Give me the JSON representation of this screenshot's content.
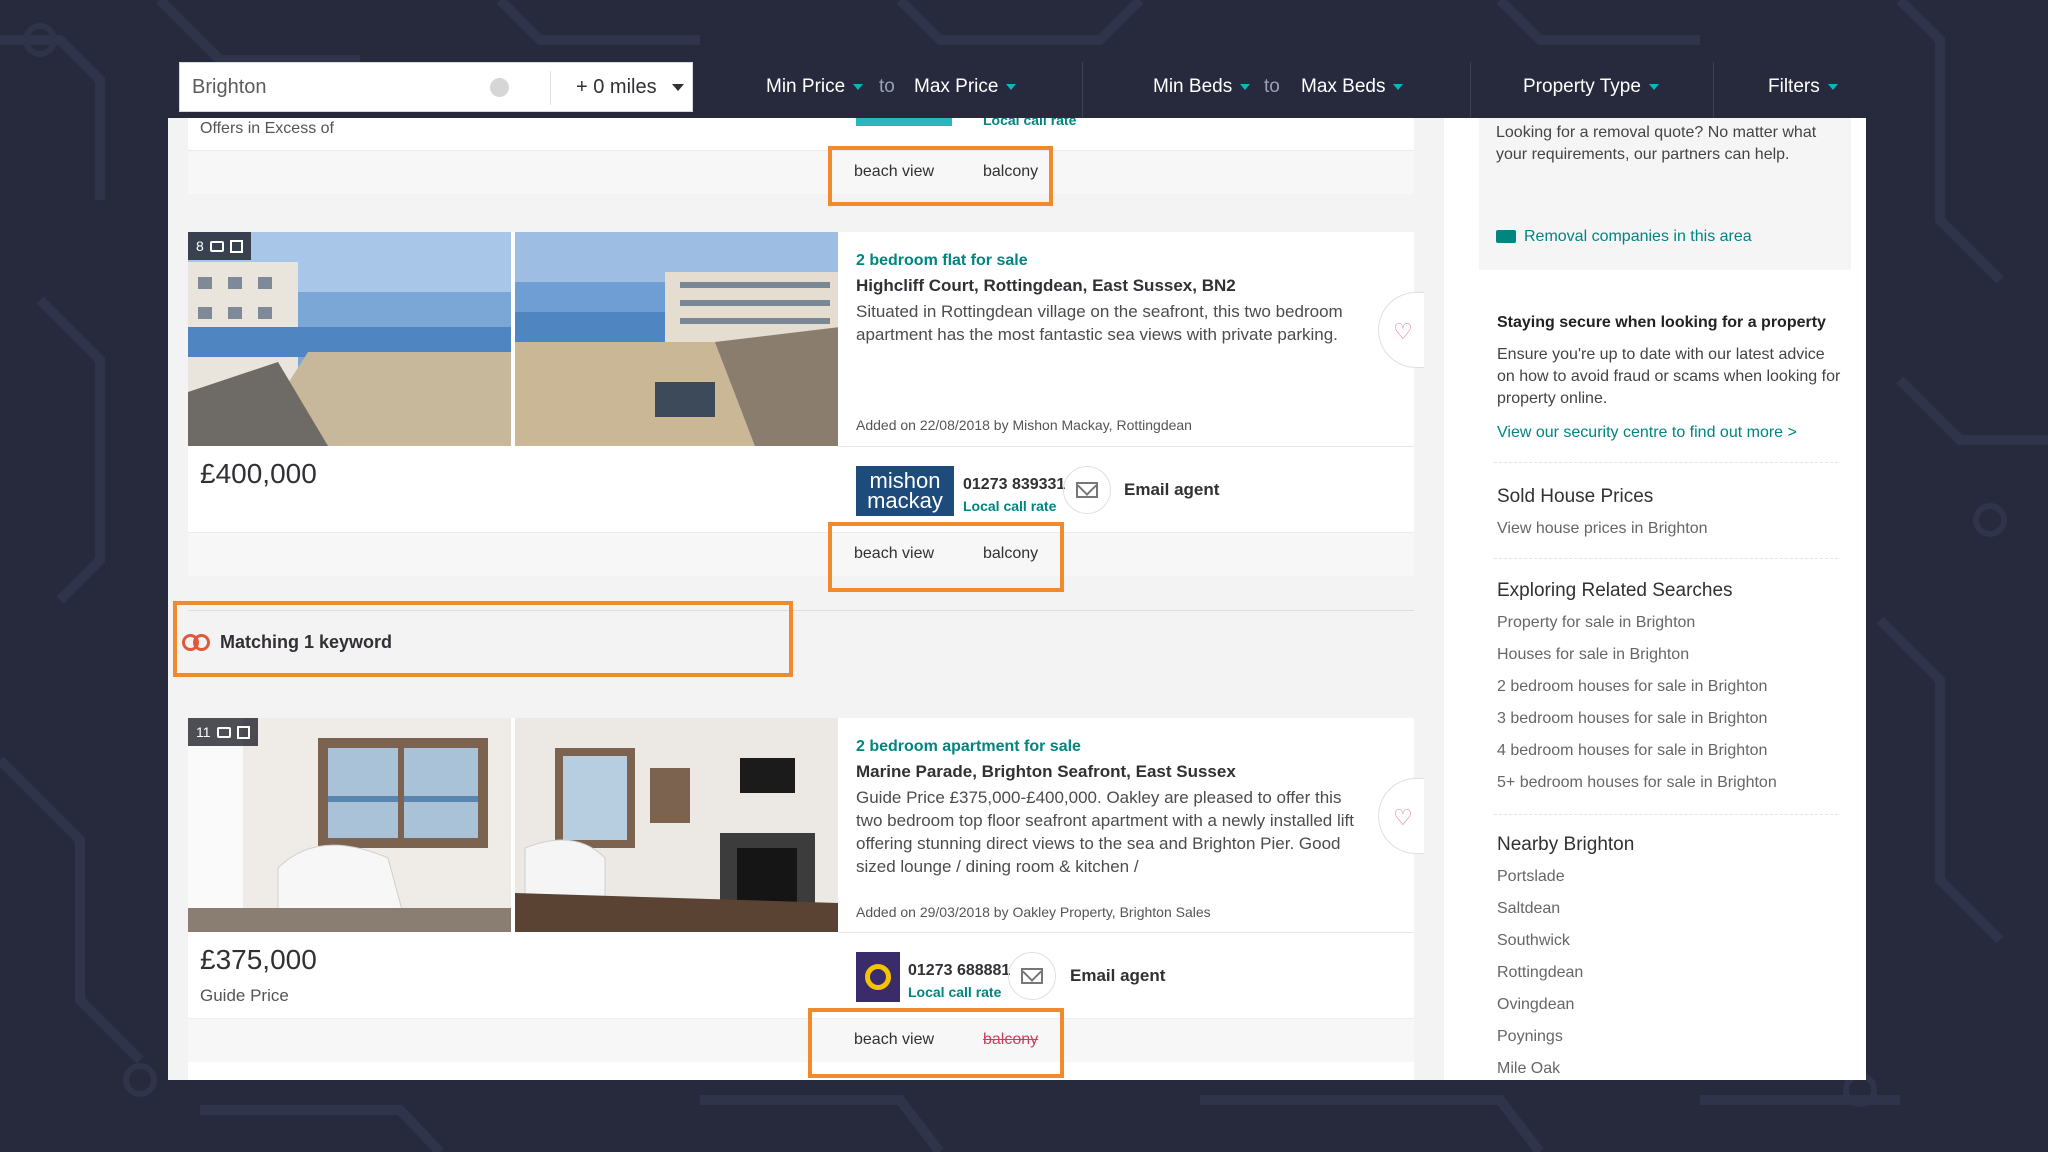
{
  "colors": {
    "bg": "#262a3c",
    "accent": "#11b4b7",
    "teal": "#00857f",
    "highlight": "#f1892d",
    "strike": "#d23b5e"
  },
  "search": {
    "location": "Brighton",
    "radius": "+ 0 miles"
  },
  "filters": {
    "min_price": "Min Price",
    "max_price": "Max Price",
    "to": "to",
    "min_beds": "Min Beds",
    "max_beds": "Max Beds",
    "property_type": "Property Type",
    "filters": "Filters"
  },
  "listing0": {
    "price_qualifier": "Offers in Excess of",
    "local_call": "Local call rate",
    "tags": [
      "beach view",
      "balcony"
    ]
  },
  "listing1": {
    "photo_count": "8",
    "type": "2 bedroom flat for sale",
    "address": "Highcliff Court, Rottingdean, East Sussex, BN2",
    "description": "Situated in Rottingdean village on the seafront, this two bedroom apartment has the most fantastic sea views with private parking.",
    "added": "Added on 22/08/2018 by Mishon Mackay, Rottingdean",
    "price": "£400,000",
    "agent_logo_top": "mishon",
    "agent_logo_bottom": "mackay",
    "phone": "01273 839331",
    "local_call": "Local call rate",
    "email": "Email agent",
    "tags": [
      "beach view",
      "balcony"
    ]
  },
  "matching": {
    "label": "Matching 1 keyword"
  },
  "listing2": {
    "photo_count": "11",
    "type": "2 bedroom apartment for sale",
    "address": "Marine Parade, Brighton Seafront, East Sussex",
    "description": "Guide Price £375,000-£400,000. Oakley are pleased to offer this two bedroom top floor seafront apartment with a newly installed lift offering stunning direct views to the sea and Brighton Pier. Good sized lounge / dining room & kitchen /",
    "added": "Added on 29/03/2018 by Oakley Property, Brighton Sales",
    "price": "£375,000",
    "price_qualifier": "Guide Price",
    "phone": "01273 688881",
    "local_call": "Local call rate",
    "email": "Email agent",
    "tags": [
      "beach view",
      "balcony"
    ]
  },
  "sidebar": {
    "removal_text": "Looking for a removal quote? No matter what your requirements, our partners can help.",
    "removal_link": "Removal companies in this area",
    "secure_title": "Staying secure when looking for a property",
    "secure_text": "Ensure you're up to date with our latest advice on how to avoid fraud or scams when looking for property online.",
    "secure_link": "View our security centre to find out more >",
    "sold_title": "Sold House Prices",
    "sold_link": "View house prices in Brighton",
    "related_title": "Exploring Related Searches",
    "related": [
      "Property for sale in Brighton",
      "Houses for sale in Brighton",
      "2 bedroom houses for sale in Brighton",
      "3 bedroom houses for sale in Brighton",
      "4 bedroom houses for sale in Brighton",
      "5+ bedroom houses for sale in Brighton"
    ],
    "nearby_title": "Nearby Brighton",
    "nearby": [
      "Portslade",
      "Saltdean",
      "Southwick",
      "Rottingdean",
      "Ovingdean",
      "Poynings",
      "Mile Oak"
    ]
  }
}
